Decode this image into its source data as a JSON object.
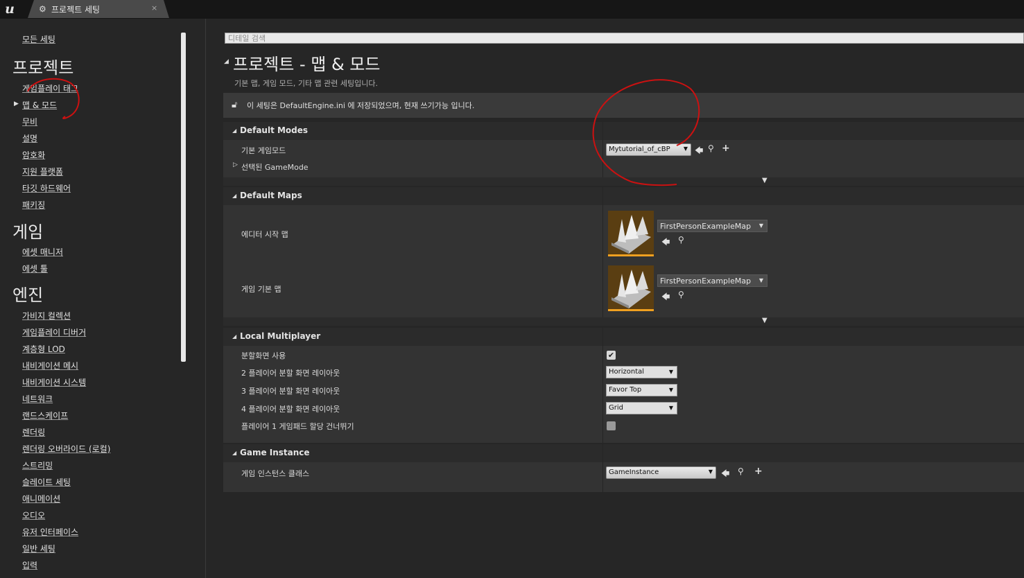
{
  "window": {
    "tab_label": "프로젝트 세팅",
    "close_label": "×"
  },
  "sidebar": {
    "all_settings": "모든 세팅",
    "categories": [
      {
        "title": "프로젝트",
        "items": [
          "게임플레이 태그",
          "맵 & 모드",
          "무비",
          "설명",
          "암호화",
          "지원 플랫폼",
          "타깃 하드웨어",
          "패키징"
        ]
      },
      {
        "title": "게임",
        "items": [
          "에셋 매니저",
          "에셋 툴"
        ]
      },
      {
        "title": "엔진",
        "items": [
          "가비지 컬렉션",
          "게임플레이 디버거",
          "계층형 LOD",
          "내비게이션 메시",
          "내비게이션 시스템",
          "네트워크",
          "랜드스케이프",
          "렌더링",
          "렌더링 오버라이드 (로컬)",
          "스트리밍",
          "슬레이트 세팅",
          "애니메이션",
          "오디오",
          "유저 인터페이스",
          "일반 세팅",
          "입력"
        ]
      }
    ],
    "selected_item": "맵 & 모드"
  },
  "search": {
    "placeholder": "디테일 검색",
    "value": ""
  },
  "page": {
    "title": "프로젝트 - 맵 & 모드",
    "description": "기본 맵, 게임 모드, 기타 맵 관련 세팅입니다.",
    "notice": "이 세팅은 DefaultEngine.ini 에 저장되었으며, 현재 쓰기가능 입니다."
  },
  "default_modes": {
    "header": "Default Modes",
    "game_mode_label": "기본 게임모드",
    "game_mode_value": "Mytutorial_of_cBP",
    "selected_gamemode_label": "선택된 GameMode"
  },
  "default_maps": {
    "header": "Default Maps",
    "editor_startup_label": "에디터 시작 맵",
    "editor_startup_value": "FirstPersonExampleMap",
    "game_default_label": "게임 기본 맵",
    "game_default_value": "FirstPersonExampleMap"
  },
  "local_multiplayer": {
    "header": "Local Multiplayer",
    "splitscreen_label": "분할화면 사용",
    "splitscreen_checked": true,
    "two_player_label": "2 플레이어 분할 화면 레이아웃",
    "two_player_value": "Horizontal",
    "three_player_label": "3 플레이어 분할 화면 레이아웃",
    "three_player_value": "Favor Top",
    "four_player_label": "4 플레이어 분할 화면 레이아웃",
    "four_player_value": "Grid",
    "skip_gamepad_label": "플레이어 1 게임패드 할당 건너뛰기",
    "skip_gamepad_checked": false
  },
  "game_instance": {
    "header": "Game Instance",
    "class_label": "게임 인스턴스 클래스",
    "class_value": "GameInstance"
  },
  "icons": {
    "logo": "unreal-logo-icon",
    "use": "arrow-left-icon",
    "browse": "magnifier-icon",
    "add": "plus-icon"
  },
  "colors": {
    "annotation": "#cc1111",
    "thumb_bar": "#f0a020"
  }
}
